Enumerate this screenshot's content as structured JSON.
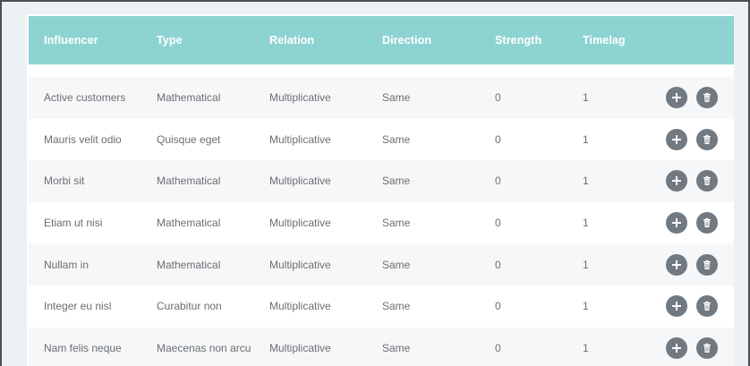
{
  "table": {
    "columns": [
      "Influencer",
      "Type",
      "Relation",
      "Direction",
      "Strength",
      "Timelag"
    ],
    "rows": [
      {
        "influencer": "Active customers",
        "type": "Mathematical",
        "relation": "Multiplicative",
        "direction": "Same",
        "strength": "0",
        "timelag": "1"
      },
      {
        "influencer": "Mauris velit odio",
        "type": "Quisque eget",
        "relation": "Multiplicative",
        "direction": "Same",
        "strength": "0",
        "timelag": "1"
      },
      {
        "influencer": "Morbi sit",
        "type": "Mathematical",
        "relation": "Multiplicative",
        "direction": "Same",
        "strength": "0",
        "timelag": "1"
      },
      {
        "influencer": "Etiam ut nisi",
        "type": "Mathematical",
        "relation": "Multiplicative",
        "direction": "Same",
        "strength": "0",
        "timelag": "1"
      },
      {
        "influencer": "Nullam in",
        "type": "Mathematical",
        "relation": "Multiplicative",
        "direction": "Same",
        "strength": "0",
        "timelag": "1"
      },
      {
        "influencer": "Integer eu nisl",
        "type": "Curabitur non",
        "relation": "Multiplicative",
        "direction": "Same",
        "strength": "0",
        "timelag": "1"
      },
      {
        "influencer": "Nam felis neque",
        "type": "Maecenas non arcu",
        "relation": "Multiplicative",
        "direction": "Same",
        "strength": "0",
        "timelag": "1"
      }
    ]
  },
  "icons": {
    "add": "plus-icon",
    "delete": "trash-icon"
  },
  "colors": {
    "header_bg": "#8dd3d2",
    "header_text": "#ffffff",
    "row_alt_bg": "#f6f7f8",
    "body_text": "#6a6e72",
    "action_button_bg": "#717981"
  }
}
